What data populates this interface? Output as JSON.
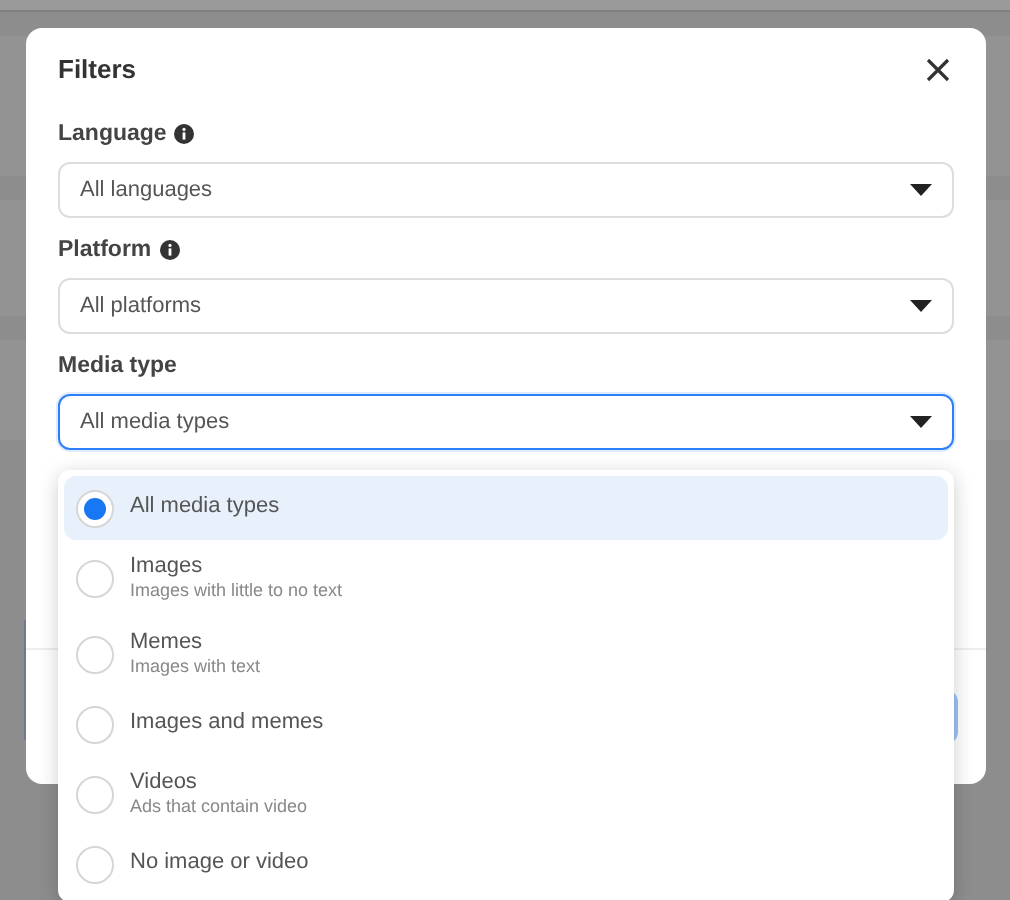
{
  "dialog": {
    "title": "Filters"
  },
  "filters": [
    {
      "label": "Language",
      "info": true,
      "value": "All languages",
      "focused": false
    },
    {
      "label": "Platform",
      "info": true,
      "value": "All platforms",
      "focused": false
    },
    {
      "label": "Media type",
      "info": false,
      "value": "All media types",
      "focused": true
    }
  ],
  "media_menu": {
    "options": [
      {
        "label": "All media types",
        "selected": true
      },
      {
        "label": "Images",
        "description": "Images with little to no text",
        "selected": false
      },
      {
        "label": "Memes",
        "description": "Images with text",
        "selected": false
      },
      {
        "label": "Images and memes",
        "selected": false
      },
      {
        "label": "Videos",
        "description": "Ads that contain video",
        "selected": false
      },
      {
        "label": "No image or video",
        "selected": false
      }
    ]
  }
}
